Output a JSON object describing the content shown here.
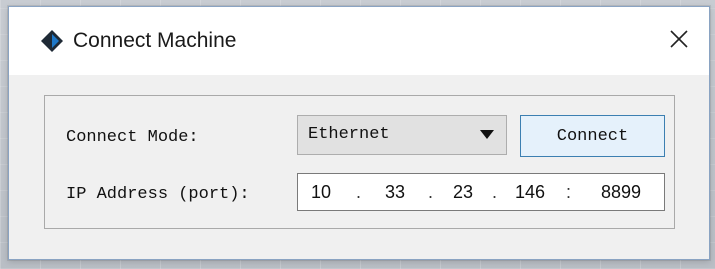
{
  "window": {
    "title": "Connect Machine",
    "close_glyph": "✕"
  },
  "form": {
    "connect_mode_label": "Connect Mode:",
    "connect_mode_value": "Ethernet",
    "connect_mode_options": [
      "Ethernet"
    ],
    "connect_button_label": "Connect",
    "ip_label": "IP Address (port):",
    "ip": {
      "octet1": "10",
      "octet2": "33",
      "octet3": "23",
      "octet4": "146",
      "port": "8899",
      "dot": ".",
      "colon": ":"
    }
  },
  "icons": {
    "app": "app-logo-icon",
    "close": "close-icon",
    "dropdown": "chevron-down-icon"
  },
  "colors": {
    "accent_border": "#3c7fb1",
    "button_fill": "#e5f1fb",
    "logo_dark": "#1f2a36",
    "logo_blue": "#1f78c8"
  }
}
